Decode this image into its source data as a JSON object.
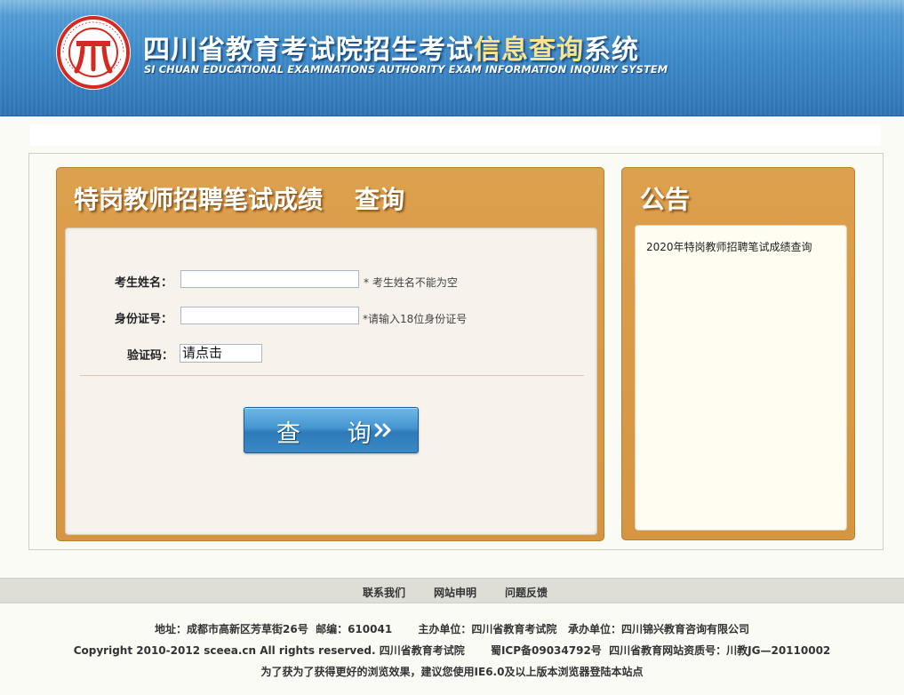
{
  "header": {
    "title_prefix": "四川省教育考试院招生考试",
    "title_highlight": "信息查询",
    "title_suffix": "系统",
    "subtitle": "SI CHUAN EDUCATIONAL EXAMINATIONS AUTHORITY EXAM INFORMATION INQUIRY SYSTEM",
    "logo_icon": "sceea-seal-logo-icon"
  },
  "query_panel": {
    "title": "特岗教师招聘笔试成绩",
    "title_action": "查询",
    "fields": {
      "name_label": "考生姓名：",
      "name_value": "",
      "name_hint": "* 考生姓名不能为空",
      "id_label": "身份证号：",
      "id_value": "",
      "id_hint": "*请输入18位身份证号",
      "captcha_label": "验证码：",
      "captcha_value": "请点击"
    },
    "submit_label": "查 询",
    "submit_icon": "double-chevron-right-icon"
  },
  "notice_panel": {
    "title": "公告",
    "items": [
      "2020年特岗教师招聘笔试成绩查询"
    ]
  },
  "footer": {
    "links": [
      "联系我们",
      "网站申明",
      "问题反馈"
    ],
    "address_line": "地址：成都市高新区芳草街26号  邮编：610041       主办单位：四川省教育考试院   承办单位：四川锦兴教育咨询有限公司",
    "copyright_line": "Copyright 2010-2012 sceea.cn All rights reserved. 四川省教育考试院       蜀ICP备09034792号  四川省教育网站资质号：川教JG—20110002",
    "browser_line": "为了获为了获得更好的浏览效果，建议您使用IE6.0及以上版本浏览器登陆本站点"
  },
  "colors": {
    "banner_blue": "#3f8ccb",
    "panel_orange": "#d99a47",
    "title_highlight": "#fbe58a",
    "button_blue": "#3a88c4"
  }
}
